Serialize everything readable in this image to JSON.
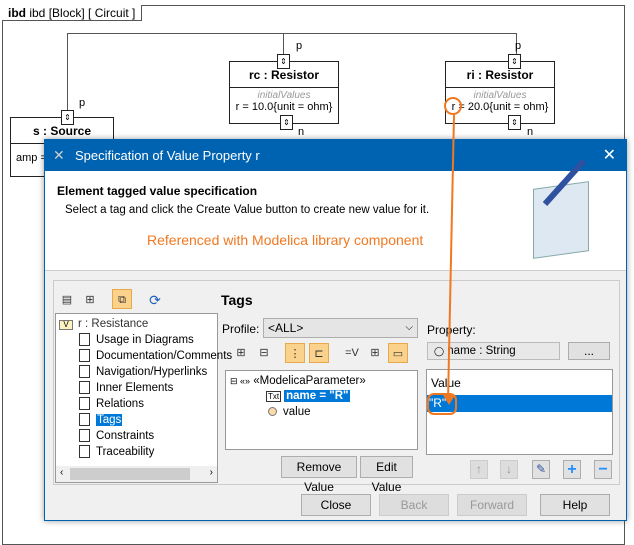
{
  "diagram": {
    "frame_label": "ibd [Block]  [ Circuit ]",
    "source": {
      "name": "s : Source",
      "value": "amp ="
    },
    "rc": {
      "name": "rc : Resistor",
      "section": "initialValues",
      "value": "r = 10.0{unit = ohm}"
    },
    "ri": {
      "name": "ri : Resistor",
      "section": "initialValues",
      "value": "r = 20.0{unit = ohm}"
    },
    "port_p": "p",
    "port_n": "n"
  },
  "dialog": {
    "title": "Specification of Value Property r",
    "header_title": "Element tagged value specification",
    "header_desc": "Select a tag and click the Create Value button to create new value for it.",
    "annotation": "Referenced with Modelica library component",
    "accent": "#0063b1",
    "annotation_color": "#f07820",
    "tree_root": "r : Resistance",
    "tree_items": [
      "Usage in Diagrams",
      "Documentation/Comments",
      "Navigation/Hyperlinks",
      "Inner Elements",
      "Relations",
      "Tags",
      "Constraints",
      "Traceability"
    ],
    "selected_item": "Tags",
    "panel_title": "Tags",
    "profile_label": "Profile:",
    "profile_value": "<ALL>",
    "stereotype": "«ModelicaParameter»",
    "tag_name": "name = \"R\"",
    "tag_value": "value",
    "property_label": "Property:",
    "property_value": "name : String",
    "browse": "...",
    "value_header": "Value",
    "value_row": "\"R\"",
    "remove_value": "Remove Value",
    "edit_value": "Edit Value",
    "buttons": {
      "close": "Close",
      "back": "Back",
      "forward": "Forward",
      "help": "Help"
    }
  }
}
